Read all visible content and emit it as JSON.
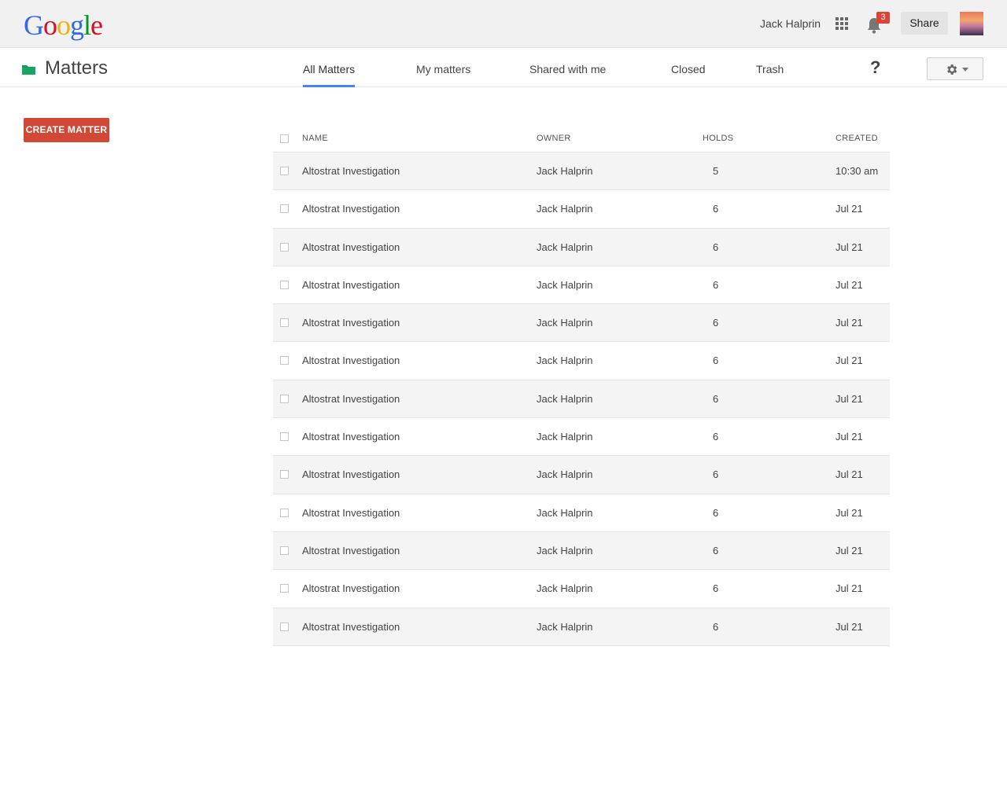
{
  "header": {
    "logo_letters": [
      {
        "char": "G",
        "color": "#3369e8"
      },
      {
        "char": "o",
        "color": "#d50f25"
      },
      {
        "char": "o",
        "color": "#eeb211"
      },
      {
        "char": "g",
        "color": "#3369e8"
      },
      {
        "char": "l",
        "color": "#009925"
      },
      {
        "char": "e",
        "color": "#d50f25"
      }
    ],
    "user_name": "Jack Halprin",
    "notification_count": "3",
    "share_label": "Share",
    "apps_icon": "apps-grid-icon",
    "bell_icon": "bell-icon"
  },
  "subheader": {
    "title": "Matters",
    "folder_icon_color": "#0f9d58",
    "tabs": [
      {
        "label": "All Matters",
        "active": true
      },
      {
        "label": "My matters",
        "active": false
      },
      {
        "label": "Shared with me",
        "active": false
      },
      {
        "label": "Closed",
        "active": false
      },
      {
        "label": "Trash",
        "active": false
      }
    ],
    "help_label": "?",
    "accent_color": "#4285f4"
  },
  "create_button": {
    "label": "CREATE MATTER",
    "color": "#d14836"
  },
  "table": {
    "columns": [
      "NAME",
      "OWNER",
      "HOLDS",
      "CREATED"
    ],
    "rows": [
      {
        "name": "Altostrat Investigation",
        "owner": "Jack Halprin",
        "holds": "5",
        "created": "10:30 am"
      },
      {
        "name": "Altostrat Investigation",
        "owner": "Jack Halprin",
        "holds": "6",
        "created": "Jul 21"
      },
      {
        "name": "Altostrat Investigation",
        "owner": "Jack Halprin",
        "holds": "6",
        "created": "Jul 21"
      },
      {
        "name": "Altostrat Investigation",
        "owner": "Jack Halprin",
        "holds": "6",
        "created": "Jul 21"
      },
      {
        "name": "Altostrat Investigation",
        "owner": "Jack Halprin",
        "holds": "6",
        "created": "Jul 21"
      },
      {
        "name": "Altostrat Investigation",
        "owner": "Jack Halprin",
        "holds": "6",
        "created": "Jul 21"
      },
      {
        "name": "Altostrat Investigation",
        "owner": "Jack Halprin",
        "holds": "6",
        "created": "Jul 21"
      },
      {
        "name": "Altostrat Investigation",
        "owner": "Jack Halprin",
        "holds": "6",
        "created": "Jul 21"
      },
      {
        "name": "Altostrat Investigation",
        "owner": "Jack Halprin",
        "holds": "6",
        "created": "Jul 21"
      },
      {
        "name": "Altostrat Investigation",
        "owner": "Jack Halprin",
        "holds": "6",
        "created": "Jul 21"
      },
      {
        "name": "Altostrat Investigation",
        "owner": "Jack Halprin",
        "holds": "6",
        "created": "Jul 21"
      },
      {
        "name": "Altostrat Investigation",
        "owner": "Jack Halprin",
        "holds": "6",
        "created": "Jul 21"
      },
      {
        "name": "Altostrat Investigation",
        "owner": "Jack Halprin",
        "holds": "6",
        "created": "Jul 21"
      }
    ]
  }
}
